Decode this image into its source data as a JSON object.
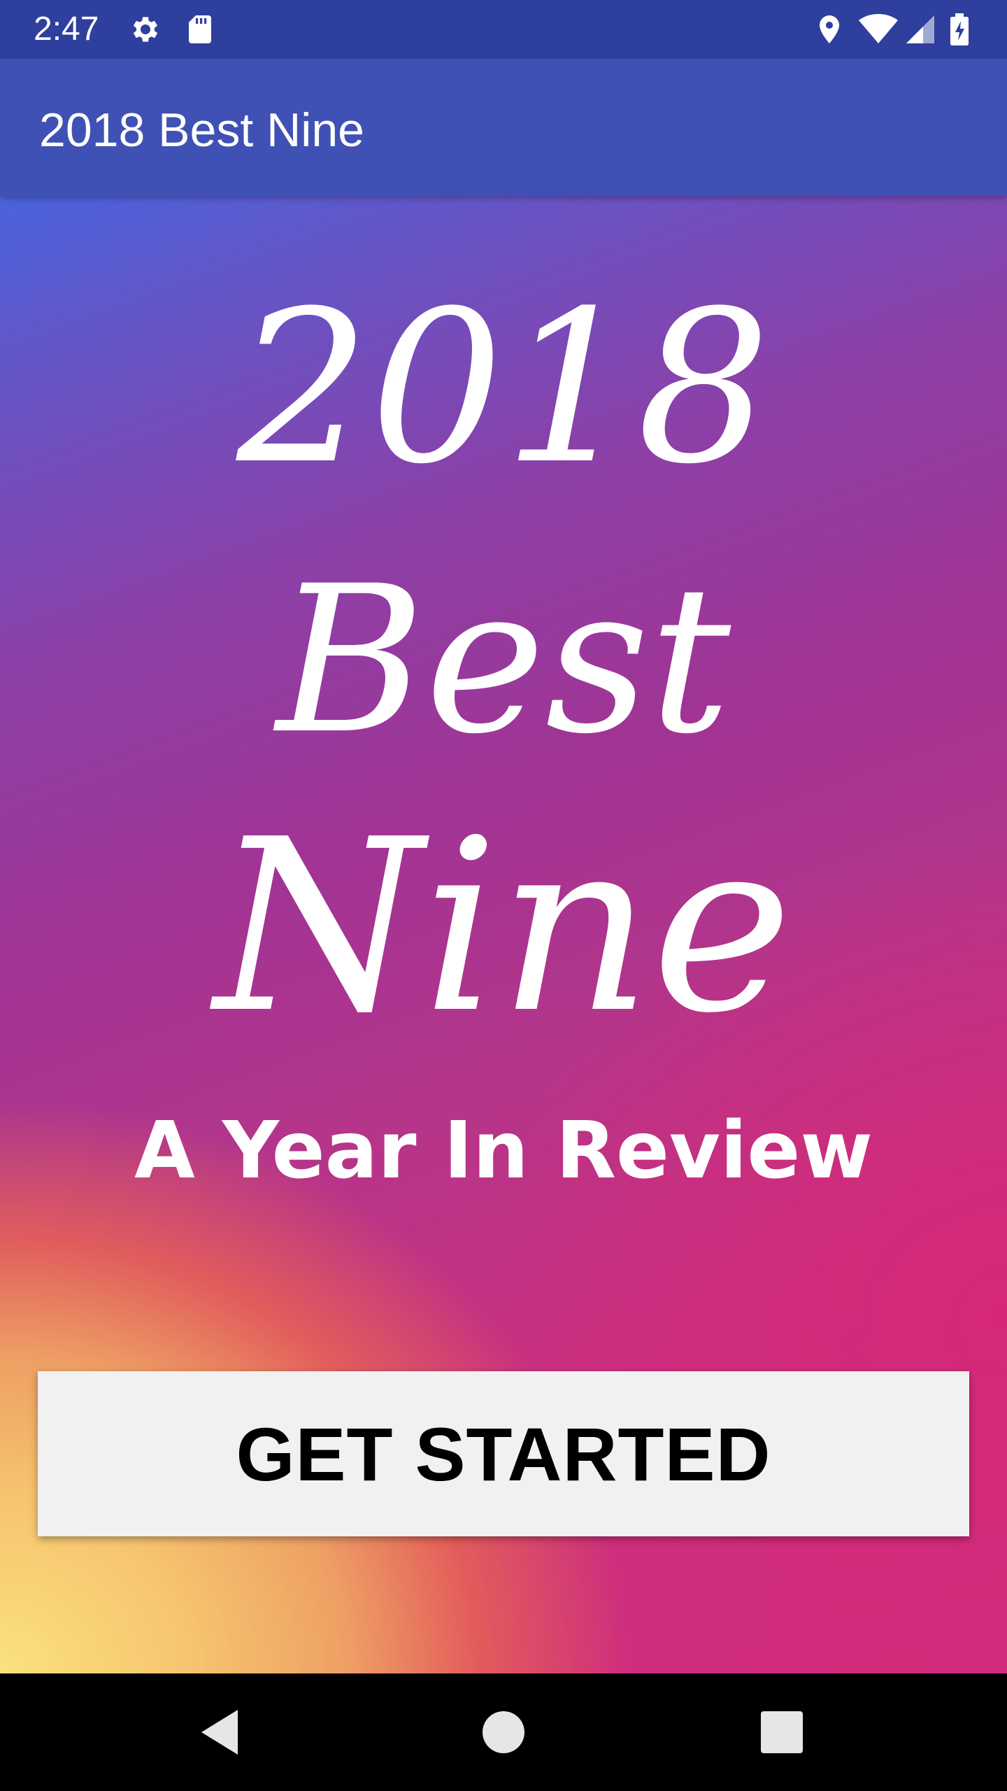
{
  "status_bar": {
    "time": "2:47",
    "icons_left": [
      "settings-icon",
      "sd-card-icon"
    ],
    "icons_right": [
      "location-icon",
      "wifi-icon",
      "signal-icon",
      "battery-charging-icon"
    ],
    "background_color": "#2f3f9e"
  },
  "app_bar": {
    "title": "2018 Best Nine",
    "background_color": "#3f51b5"
  },
  "hero": {
    "line1": "2018",
    "line2": "Best",
    "line3": "Nine",
    "tagline": "A Year In Review"
  },
  "main": {
    "get_started_label": "GET STARTED"
  },
  "nav_bar": {
    "buttons": [
      "back-icon",
      "home-icon",
      "recents-icon"
    ]
  }
}
